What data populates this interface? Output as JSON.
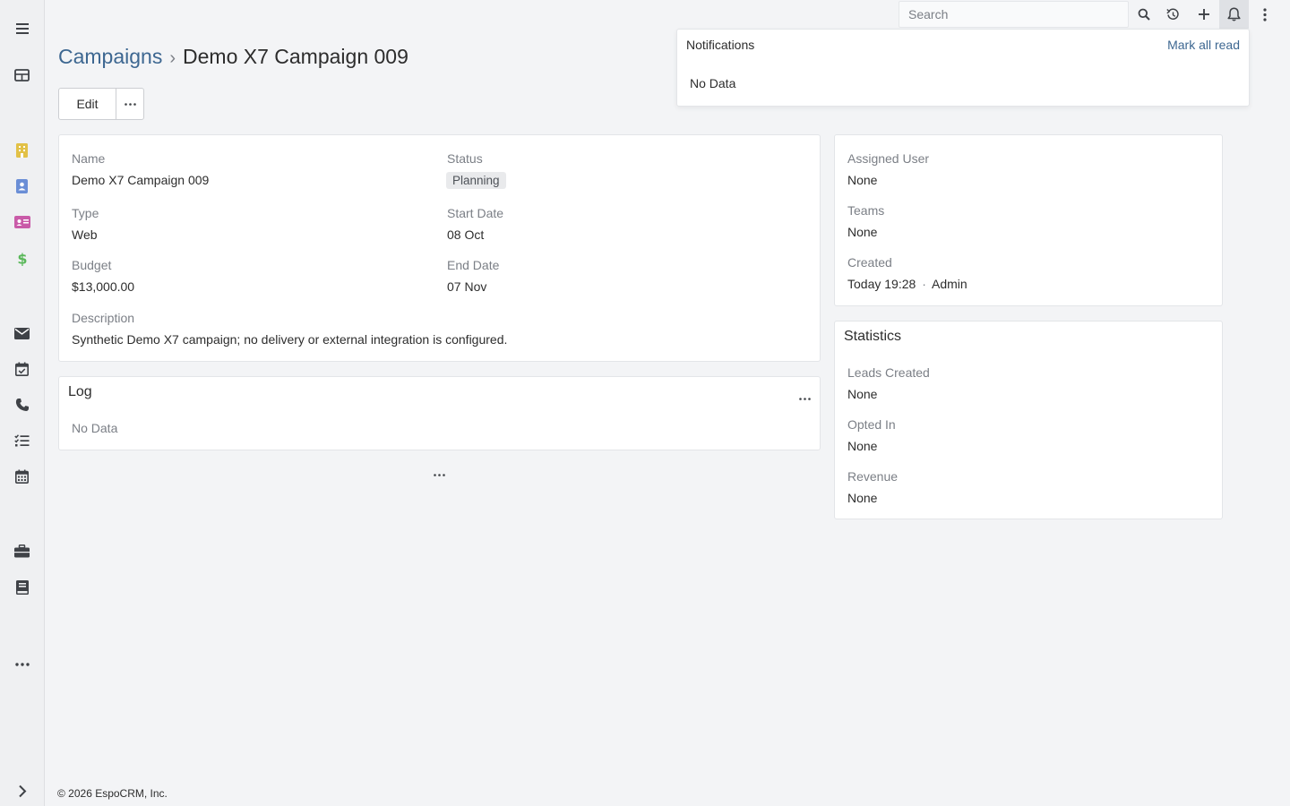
{
  "topbar": {
    "search_placeholder": "Search"
  },
  "icons": {
    "menu": "hamburger-icon",
    "dashboard": "dashboard-icon",
    "accounts": "building-icon",
    "contacts": "contact-icon",
    "leads": "id-card-icon",
    "opportunities": "dollar-icon",
    "emails": "envelope-icon",
    "meetings": "calendar-check-icon",
    "calls": "phone-icon",
    "tasks": "tasks-icon",
    "calendar": "calendar-icon",
    "cases": "briefcase-icon",
    "knowledge_base": "book-icon",
    "more": "ellipsis-icon",
    "collapse": "chevron-right-icon"
  },
  "colors": {
    "accounts": "#e2c147",
    "contacts": "#6a8ed6",
    "leads": "#c95ba8",
    "opportunities": "#5ab85a",
    "link": "#3d6791"
  },
  "header": {
    "breadcrumb_parent": "Campaigns",
    "breadcrumb_separator": "›",
    "title": "Demo X7 Campaign 009",
    "edit_label": "Edit"
  },
  "detail": {
    "name_label": "Name",
    "name_value": "Demo X7 Campaign 009",
    "status_label": "Status",
    "status_value": "Planning",
    "type_label": "Type",
    "type_value": "Web",
    "start_date_label": "Start Date",
    "start_date_value": "08 Oct",
    "budget_label": "Budget",
    "budget_value": "$13,000.00",
    "end_date_label": "End Date",
    "end_date_value": "07 Nov",
    "description_label": "Description",
    "description_value": "Synthetic Demo X7 campaign; no delivery or external integration is configured."
  },
  "side": {
    "assigned_user_label": "Assigned User",
    "assigned_user_value": "None",
    "teams_label": "Teams",
    "teams_value": "None",
    "created_label": "Created",
    "created_value": "Today 19:28",
    "created_separator": "·",
    "created_by": "Admin"
  },
  "statistics": {
    "title": "Statistics",
    "leads_created_label": "Leads Created",
    "leads_created_value": "None",
    "opted_in_label": "Opted In",
    "opted_in_value": "None",
    "revenue_label": "Revenue",
    "revenue_value": "None"
  },
  "log": {
    "title": "Log",
    "empty": "No Data"
  },
  "notifications": {
    "title": "Notifications",
    "mark_all_read": "Mark all read",
    "empty": "No Data"
  },
  "footer": {
    "text": "© 2026 EspoCRM, Inc."
  }
}
